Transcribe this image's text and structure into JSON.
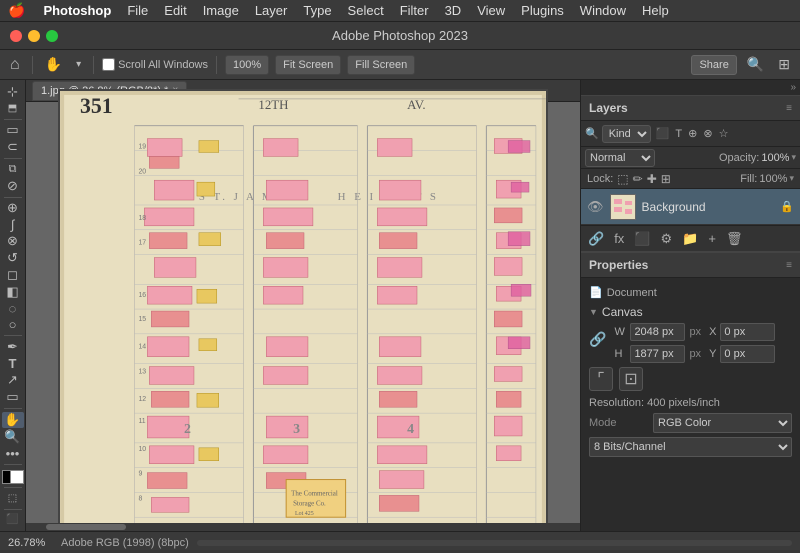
{
  "menubar": {
    "apple": "🍎",
    "items": [
      {
        "label": "Photoshop",
        "active": true
      },
      {
        "label": "File"
      },
      {
        "label": "Edit"
      },
      {
        "label": "Image"
      },
      {
        "label": "Layer"
      },
      {
        "label": "Type"
      },
      {
        "label": "Select",
        "active": true
      },
      {
        "label": "Filter"
      },
      {
        "label": "3D"
      },
      {
        "label": "View"
      },
      {
        "label": "Plugins"
      },
      {
        "label": "Window"
      },
      {
        "label": "Help"
      }
    ]
  },
  "titlebar": {
    "title": "Adobe Photoshop 2023"
  },
  "optionsbar": {
    "zoom_value": "100%",
    "fit_screen": "Fit Screen",
    "fill_screen": "Fill Screen",
    "share": "Share",
    "scroll_all_windows": "Scroll All Windows"
  },
  "tab": {
    "name": "1.jpg @ 26.8% (RGB/8*) *",
    "close": "×"
  },
  "layers_panel": {
    "title": "Layers",
    "search_placeholder": "Kind",
    "blend_mode": "Normal",
    "opacity_label": "Opacity:",
    "opacity_value": "100%",
    "fill_label": "Fill:",
    "fill_value": "100%",
    "lock_label": "Lock:",
    "layer_name": "Background",
    "bottom_icons": [
      "🔗",
      "fx",
      "⬛",
      "⚙",
      "📁",
      "🗑"
    ]
  },
  "properties_panel": {
    "title": "Properties",
    "document_label": "Document",
    "canvas_label": "Canvas",
    "width_label": "W",
    "height_label": "H",
    "width_value": "2048 px",
    "height_value": "1877 px",
    "x_label": "X",
    "y_label": "Y",
    "x_value": "0 px",
    "y_value": "0 px",
    "resolution_label": "Resolution: 400 pixels/inch",
    "mode_label": "Mode",
    "mode_value": "RGB Color",
    "bitdepth_label": "8 Bits/Channel"
  },
  "statusbar": {
    "zoom": "26.78%",
    "info": "Adobe RGB (1998) (8bpc)"
  },
  "colors": {
    "accent_blue": "#4a6070",
    "panel_bg": "#2b2b2b",
    "toolbar_bg": "#3a3a3a",
    "border": "#222222",
    "text_primary": "#cccccc",
    "text_secondary": "#aaaaaa",
    "map_bg": "#e8dfc0",
    "pink_building": "#f0a0b0",
    "yellow_building": "#e8c860"
  }
}
